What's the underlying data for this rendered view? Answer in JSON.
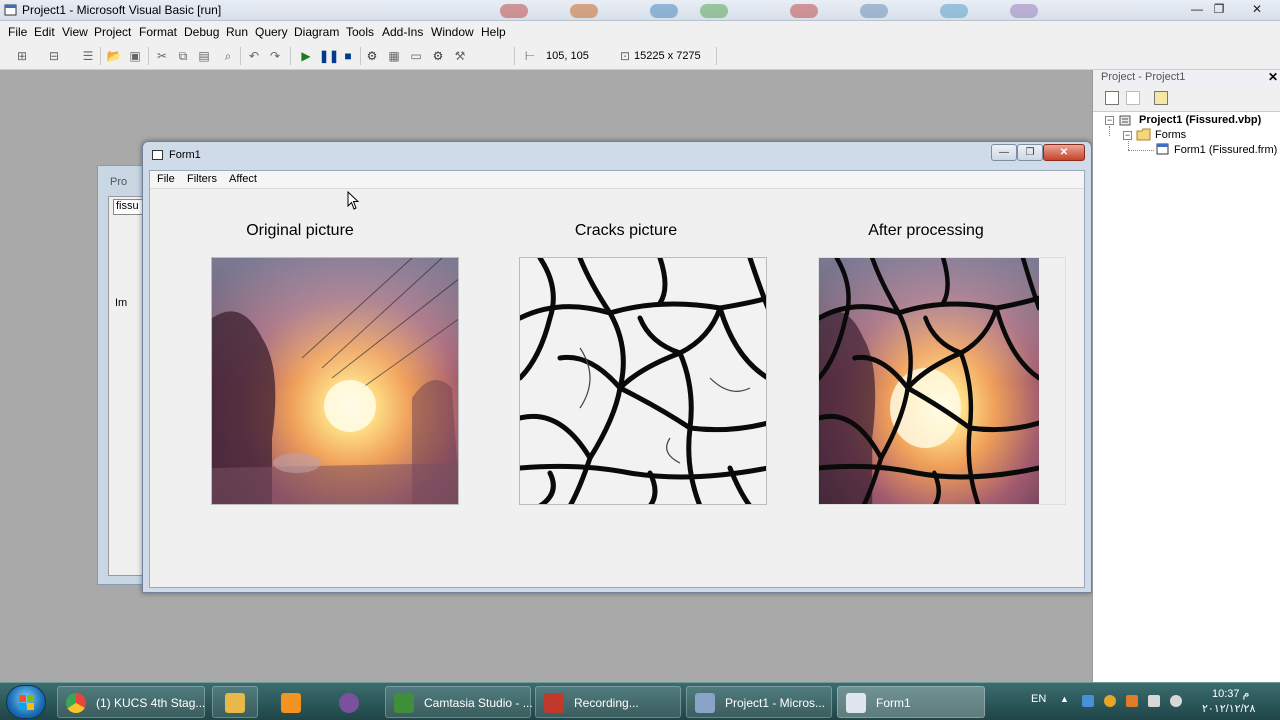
{
  "window": {
    "title": "Project1 - Microsoft Visual Basic [run]",
    "controls": {
      "minimize": "—",
      "restore": "❐",
      "close": "✕"
    }
  },
  "menu": [
    "File",
    "Edit",
    "View",
    "Project",
    "Format",
    "Debug",
    "Run",
    "Query",
    "Diagram",
    "Tools",
    "Add-Ins",
    "Window",
    "Help"
  ],
  "toolbar": {
    "position": "105, 105",
    "size": "15225 x 7275"
  },
  "background_window": {
    "title": "Pro",
    "field": "fissu",
    "sub": "Im"
  },
  "form": {
    "title": "Form1",
    "menu": [
      "File",
      "Filters",
      "Affect"
    ],
    "captions": {
      "original": "Original picture",
      "cracks": "Cracks picture",
      "after": "After processing"
    }
  },
  "project_explorer": {
    "title": "Project - Project1",
    "close": "✕",
    "project": "Project1 (Fissured.vbp)",
    "folder": "Forms",
    "form_item": "Form1 (Fissured.frm)"
  },
  "taskbar": {
    "items": [
      {
        "label": "(1) KUCS 4th Stag...",
        "icon": "chrome-icon",
        "color": "#e8453c"
      },
      {
        "label": "",
        "icon": "folder-icon",
        "color": "#e8b84a"
      },
      {
        "label": "",
        "icon": "media-player-icon",
        "color": "#f29322"
      },
      {
        "label": "",
        "icon": "viber-icon",
        "color": "#7b519d"
      },
      {
        "label": "Camtasia Studio - ...",
        "icon": "camtasia-icon",
        "color": "#3f8f3a"
      },
      {
        "label": "Recording...",
        "icon": "recording-icon",
        "color": "#c0392b"
      },
      {
        "label": "Project1 - Micros...",
        "icon": "vb-icon",
        "color": "#8aa4c8"
      },
      {
        "label": "Form1",
        "icon": "form-icon",
        "color": "#dfe6ee"
      }
    ],
    "language": "EN",
    "time": "10:37 م",
    "date": "٢٠١٢/١٢/٢٨"
  },
  "colors": {
    "workspace": "#a9a9a9",
    "taskbar": "#2b5a5c",
    "form_frame": "#cfdbe8"
  }
}
